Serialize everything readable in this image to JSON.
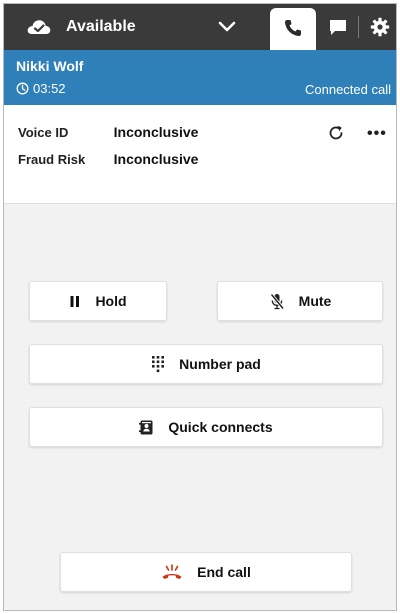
{
  "topbar": {
    "status_label": "Available",
    "status_icon": "cloud-check-icon",
    "tabs": [
      "phone-icon",
      "chat-icon",
      "gear-icon"
    ]
  },
  "contact": {
    "name": "Nikki Wolf",
    "timer": "03:52",
    "status": "Connected call",
    "color": "#2f7fb8"
  },
  "voice_id": {
    "rows": [
      {
        "key": "Voice ID",
        "value": "Inconclusive"
      },
      {
        "key": "Fraud Risk",
        "value": "Inconclusive"
      }
    ]
  },
  "actions": {
    "hold_label": "Hold",
    "mute_label": "Mute",
    "numpad_label": "Number pad",
    "quick_label": "Quick connects",
    "end_label": "End call",
    "end_color": "#d13212"
  }
}
